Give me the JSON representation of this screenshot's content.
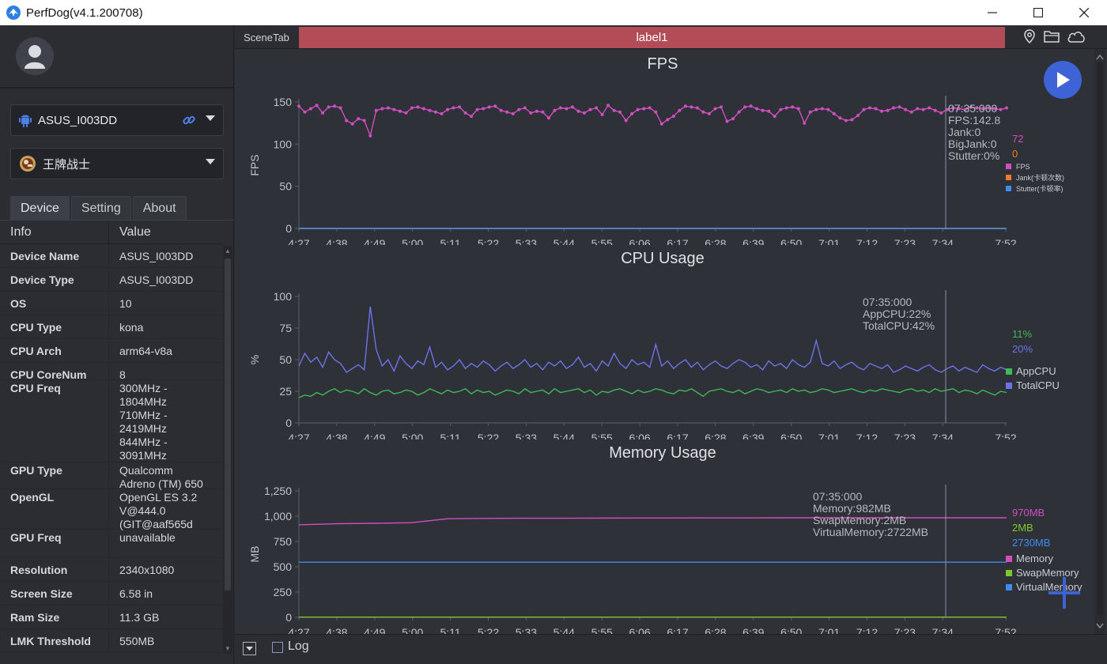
{
  "window": {
    "title": "PerfDog(v4.1.200708)"
  },
  "device_selector": {
    "label": "ASUS_I003DD"
  },
  "app_selector": {
    "label": "王牌战士"
  },
  "tabs": [
    {
      "label": "Device",
      "active": true
    },
    {
      "label": "Setting",
      "active": false
    },
    {
      "label": "About",
      "active": false
    }
  ],
  "info_table": {
    "headers": [
      "Info",
      "Value"
    ],
    "rows": [
      {
        "key": "Device Name",
        "value": "ASUS_I003DD"
      },
      {
        "key": "Device Type",
        "value": "ASUS_I003DD"
      },
      {
        "key": "OS",
        "value": "10"
      },
      {
        "key": "CPU Type",
        "value": "kona"
      },
      {
        "key": "CPU Arch",
        "value": "arm64-v8a"
      },
      {
        "key": "CPU CoreNum",
        "value": "8"
      },
      {
        "key": "CPU Freq",
        "value": "300MHz -\n1804MHz\n710MHz -\n2419MHz\n844MHz -\n3091MHz"
      },
      {
        "key": "GPU Type",
        "value": "Qualcomm\nAdreno (TM) 650"
      },
      {
        "key": "OpenGL",
        "value": "OpenGL ES 3.2\nV@444.0\n(GIT@aaf565d"
      },
      {
        "key": "GPU Freq",
        "value": "unavailable"
      },
      {
        "key": "Resolution",
        "value": "2340x1080"
      },
      {
        "key": "Screen Size",
        "value": "6.58 in"
      },
      {
        "key": "Ram Size",
        "value": "11.3 GB"
      },
      {
        "key": "LMK Threshold",
        "value": "550MB"
      }
    ]
  },
  "scene": {
    "tab_label": "SceneTab",
    "label": "label1"
  },
  "bottom": {
    "log_label": "Log"
  },
  "colors": {
    "fps": "#d04ec0",
    "jank": "#f07a2a",
    "stutter": "#3f8cf0",
    "app_cpu": "#3fb858",
    "total_cpu": "#6d72e8",
    "memory": "#d04ec0",
    "swap": "#7ec82c",
    "virtual": "#3f8cf0",
    "label_bar": "#b24c56",
    "range": "#2aa7ec"
  },
  "chart_data": [
    {
      "type": "line",
      "title": "FPS",
      "ylabel": "FPS",
      "ylim": [
        0,
        150
      ],
      "yticks": [
        "150",
        "100",
        "50",
        "0"
      ],
      "x_ticks": [
        "4:27",
        "4:38",
        "4:49",
        "5:00",
        "5:11",
        "5:22",
        "5:33",
        "5:44",
        "5:55",
        "6:06",
        "6:17",
        "6:28",
        "6:39",
        "6:50",
        "7:01",
        "7:12",
        "7:23",
        "7:34",
        "7:52"
      ],
      "tooltip": [
        "07:35:000",
        "FPS:142.8",
        "Jank:0",
        "BigJank:0",
        "Stutter:0%"
      ],
      "legend_values": [
        "72",
        "0"
      ],
      "legend": [
        "FPS",
        "Jank(卡顿次数)",
        "Stutter(卡顿率)"
      ],
      "series": [
        {
          "name": "FPS",
          "values": [
            145,
            138,
            142,
            146,
            137,
            144,
            145,
            143,
            128,
            124,
            130,
            128,
            110,
            140,
            142,
            143,
            141,
            139,
            137,
            143,
            144,
            142,
            140,
            138,
            136,
            141,
            143,
            144,
            137,
            133,
            141,
            142,
            144,
            145,
            140,
            138,
            136,
            141,
            143,
            137,
            139,
            138,
            131,
            140,
            143,
            142,
            144,
            139,
            137,
            141,
            143,
            135,
            146,
            140,
            138,
            128,
            136,
            141,
            142,
            143,
            138,
            124,
            129,
            133,
            140,
            145,
            144,
            143,
            138,
            136,
            142,
            144,
            127,
            130,
            138,
            144,
            145,
            142,
            140,
            139,
            133,
            141,
            143,
            144,
            142,
            125,
            138,
            141,
            142,
            141,
            136,
            131,
            128,
            129,
            134,
            141,
            143,
            142,
            139,
            140,
            143,
            144,
            141,
            138,
            142,
            141,
            143,
            140,
            137,
            141,
            143,
            142,
            141,
            144,
            143,
            142,
            143,
            142,
            141,
            143
          ]
        },
        {
          "name": "Jank",
          "values": [
            0
          ]
        },
        {
          "name": "Stutter",
          "values": [
            0
          ]
        }
      ]
    },
    {
      "type": "line",
      "title": "CPU Usage",
      "ylabel": "%",
      "ylim": [
        0,
        100
      ],
      "yticks": [
        "100",
        "75",
        "50",
        "25",
        "0"
      ],
      "x_ticks": [
        "4:27",
        "4:38",
        "4:49",
        "5:00",
        "5:11",
        "5:22",
        "5:33",
        "5:44",
        "5:55",
        "6:06",
        "6:17",
        "6:28",
        "6:39",
        "6:50",
        "7:01",
        "7:12",
        "7:23",
        "7:34",
        "7:52"
      ],
      "tooltip": [
        "07:35:000",
        "AppCPU:22%",
        "TotalCPU:42%"
      ],
      "legend_values": [
        "11%",
        "20%"
      ],
      "legend": [
        "AppCPU",
        "TotalCPU"
      ],
      "series": [
        {
          "name": "AppCPU",
          "values": [
            20,
            22,
            21,
            24,
            22,
            25,
            27,
            24,
            26,
            25,
            23,
            27,
            24,
            22,
            25,
            26,
            23,
            24,
            26,
            25,
            22,
            24,
            27,
            25,
            23,
            26,
            24,
            25,
            27,
            23,
            26,
            24,
            25,
            22,
            24,
            26,
            25,
            23,
            27,
            24,
            25,
            26,
            23,
            27,
            24,
            25,
            26,
            27,
            24,
            26,
            22,
            25,
            24,
            26,
            27,
            25,
            23,
            26,
            24,
            25,
            27,
            26,
            24,
            23,
            26,
            25,
            27,
            24,
            21,
            25,
            26,
            27,
            25,
            24,
            26,
            23,
            25,
            27,
            26,
            24,
            25,
            26,
            24,
            27,
            25,
            26,
            24,
            25,
            27,
            26,
            24,
            25,
            26,
            27,
            25,
            24,
            26,
            25,
            27,
            26,
            25,
            24,
            26,
            27,
            25,
            26,
            24,
            27,
            25,
            26,
            27,
            24,
            26,
            25,
            23,
            26,
            24,
            22,
            25,
            24
          ]
        },
        {
          "name": "TotalCPU",
          "values": [
            45,
            55,
            48,
            52,
            44,
            56,
            50,
            47,
            40,
            43,
            46,
            42,
            92,
            58,
            45,
            50,
            41,
            53,
            47,
            43,
            49,
            46,
            60,
            44,
            48,
            42,
            45,
            50,
            43,
            47,
            44,
            49,
            46,
            41,
            45,
            48,
            43,
            46,
            50,
            44,
            47,
            42,
            48,
            45,
            49,
            43,
            46,
            52,
            44,
            47,
            41,
            49,
            45,
            55,
            47,
            43,
            50,
            46,
            48,
            44,
            62,
            45,
            49,
            43,
            47,
            50,
            44,
            48,
            42,
            46,
            49,
            45,
            43,
            47,
            50,
            48,
            44,
            46,
            42,
            49,
            45,
            47,
            43,
            50,
            46,
            44,
            48,
            65,
            47,
            45,
            49,
            43,
            46,
            48,
            44,
            42,
            47,
            45,
            43,
            46,
            40,
            42,
            45,
            43,
            41,
            44,
            46,
            42,
            40,
            43,
            45,
            41,
            44,
            42,
            40,
            46,
            43,
            41,
            44,
            42
          ]
        }
      ]
    },
    {
      "type": "line",
      "title": "Memory Usage",
      "ylabel": "MB",
      "ylim": [
        0,
        1250
      ],
      "yticks": [
        "1,250",
        "1,000",
        "750",
        "500",
        "250",
        "0"
      ],
      "x_ticks": [
        "4:27",
        "4:38",
        "4:49",
        "5:00",
        "5:11",
        "5:22",
        "5:33",
        "5:44",
        "5:55",
        "6:06",
        "6:17",
        "6:28",
        "6:39",
        "6:50",
        "7:01",
        "7:12",
        "7:23",
        "7:34",
        "7:52"
      ],
      "tooltip": [
        "07:35:000",
        "Memory:982MB",
        "SwapMemory:2MB",
        "VirtualMemory:2722MB"
      ],
      "legend_values": [
        "970MB",
        "2MB",
        "2730MB"
      ],
      "legend": [
        "Memory",
        "SwapMemory",
        "VirtualMemory"
      ],
      "series": [
        {
          "name": "Memory",
          "values": [
            915,
            925,
            930,
            935,
            975,
            978,
            980,
            980,
            981,
            982,
            982,
            983,
            983,
            984,
            984,
            984,
            984,
            984,
            984,
            984
          ]
        },
        {
          "name": "SwapMemory",
          "values": [
            2,
            2
          ]
        },
        {
          "name": "VirtualMemory",
          "values": [
            545,
            545
          ]
        }
      ]
    }
  ]
}
